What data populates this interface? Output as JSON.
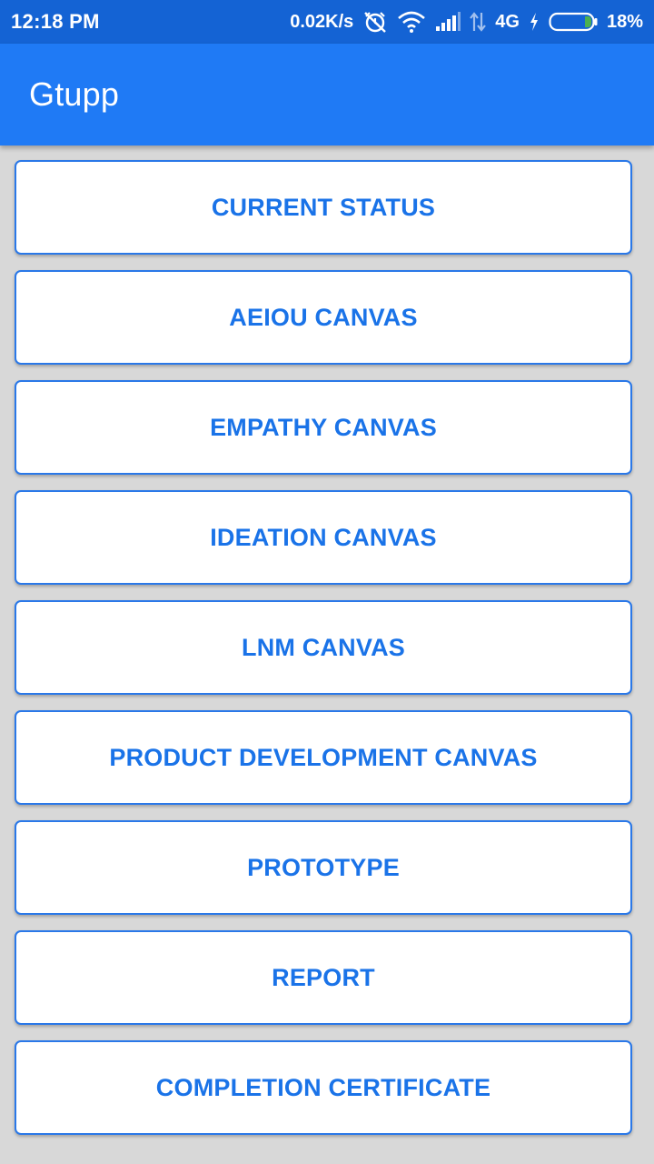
{
  "status_bar": {
    "time": "12:18 PM",
    "network_speed": "0.02K/s",
    "network_type": "4G",
    "battery_percent": "18%",
    "icons": [
      "alarm-off-icon",
      "wifi-icon",
      "signal-icon",
      "data-arrows-icon",
      "charging-icon",
      "battery-icon"
    ]
  },
  "app_bar": {
    "title": "Gtupp"
  },
  "menu": {
    "items": [
      {
        "label": "CURRENT STATUS"
      },
      {
        "label": "AEIOU CANVAS"
      },
      {
        "label": "EMPATHY CANVAS"
      },
      {
        "label": "IDEATION CANVAS"
      },
      {
        "label": "LNM CANVAS"
      },
      {
        "label": "PRODUCT DEVELOPMENT CANVAS"
      },
      {
        "label": "PROTOTYPE"
      },
      {
        "label": "REPORT"
      },
      {
        "label": "COMPLETION CERTIFICATE"
      }
    ]
  },
  "colors": {
    "status_bar": "#1463d4",
    "app_bar": "#1f7af5",
    "background": "#d8d8d8",
    "button_text": "#1a73e8",
    "button_border": "#2a78e8",
    "battery_level": "#4caf50"
  }
}
